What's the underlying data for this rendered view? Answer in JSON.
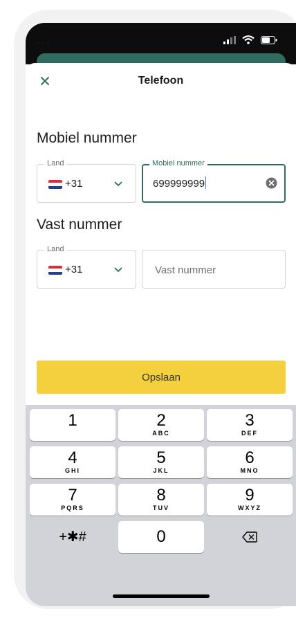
{
  "status_bar": {
    "time": "..."
  },
  "sheet": {
    "close_icon": "close-icon",
    "title": "Telefoon"
  },
  "mobile": {
    "section_title": "Mobiel nummer",
    "country_legend": "Land",
    "country_flag": "nl-flag",
    "dial_code": "+31",
    "number_legend": "Mobiel nummer",
    "number_value": "699999999"
  },
  "landline": {
    "section_title": "Vast nummer",
    "country_legend": "Land",
    "country_flag": "nl-flag",
    "dial_code": "+31",
    "number_placeholder": "Vast nummer"
  },
  "save_label": "Opslaan",
  "keypad": {
    "keys": [
      {
        "digit": "1",
        "letters": ""
      },
      {
        "digit": "2",
        "letters": "ABC"
      },
      {
        "digit": "3",
        "letters": "DEF"
      },
      {
        "digit": "4",
        "letters": "GHI"
      },
      {
        "digit": "5",
        "letters": "JKL"
      },
      {
        "digit": "6",
        "letters": "MNO"
      },
      {
        "digit": "7",
        "letters": "PQRS"
      },
      {
        "digit": "8",
        "letters": "TUV"
      },
      {
        "digit": "9",
        "letters": "WXYZ"
      },
      {
        "digit": "0",
        "letters": ""
      }
    ],
    "symbols": "+✱#",
    "delete_icon": "backspace-icon"
  },
  "colors": {
    "accent": "#2f6b5e",
    "save_button": "#f4cf3e",
    "keypad_bg": "#d1d3d9"
  }
}
